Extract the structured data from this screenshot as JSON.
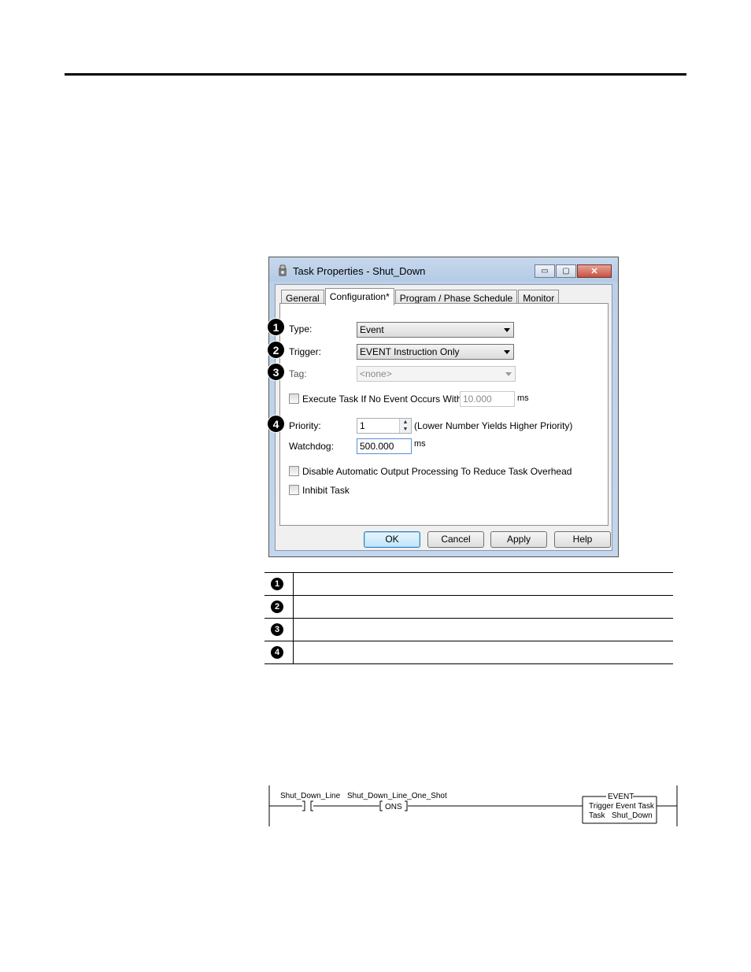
{
  "dialog": {
    "title": "Task Properties - Shut_Down",
    "window_buttons": {
      "minimize": "▭",
      "maximize": "▢",
      "close": "✕"
    },
    "tabs": [
      {
        "label": "General"
      },
      {
        "label": "Configuration*"
      },
      {
        "label": "Program / Phase Schedule"
      },
      {
        "label": "Monitor"
      }
    ],
    "type": {
      "label": "Type:",
      "value": "Event"
    },
    "trigger": {
      "label": "Trigger:",
      "value": "EVENT Instruction Only"
    },
    "tag": {
      "label": "Tag:",
      "value": "<none>"
    },
    "execute_task": {
      "label": "Execute Task If No Event Occurs Within",
      "value": "10.000",
      "unit": "ms"
    },
    "priority": {
      "label": "Priority:",
      "value": "1",
      "note": "(Lower Number Yields Higher Priority)"
    },
    "watchdog": {
      "label": "Watchdog:",
      "value": "500.000",
      "unit": "ms"
    },
    "disable_output": {
      "label": "Disable Automatic Output Processing To Reduce Task Overhead"
    },
    "inhibit_task": {
      "label": "Inhibit Task"
    },
    "buttons": {
      "ok": "OK",
      "cancel": "Cancel",
      "apply": "Apply",
      "help": "Help"
    }
  },
  "callouts": [
    "1",
    "2",
    "3",
    "4"
  ],
  "legend": [
    {
      "num": "1",
      "text": ""
    },
    {
      "num": "2",
      "text": ""
    },
    {
      "num": "3",
      "text": ""
    },
    {
      "num": "4",
      "text": ""
    }
  ],
  "ladder": {
    "contact_tag": "Shut_Down_Line",
    "ons_tag": "Shut_Down_Line_One_Shot",
    "ons_label": "ONS",
    "event_box": {
      "title": "EVENT",
      "line1": "Trigger Event Task",
      "line2_label": "Task",
      "line2_value": "Shut_Down"
    }
  }
}
